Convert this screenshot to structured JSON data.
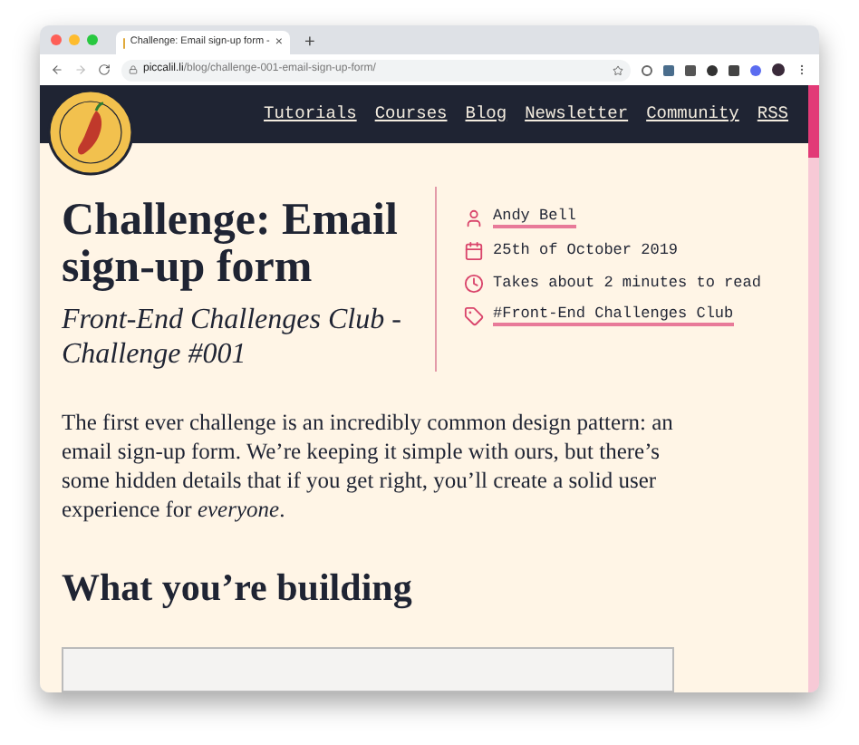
{
  "browser": {
    "tab_title": "Challenge: Email sign-up form -",
    "tab_close": "×",
    "new_tab": "+",
    "url_host": "piccalil.li",
    "url_path": "/blog/challenge-001-email-sign-up-form/"
  },
  "nav": {
    "links": [
      "Tutorials",
      "Courses",
      "Blog",
      "Newsletter",
      "Community",
      "RSS"
    ]
  },
  "article": {
    "title": "Challenge: Email sign-up form",
    "subtitle": "Front-End Challenges Club - Challenge #001",
    "meta": [
      {
        "kind": "author",
        "text": "Andy Bell",
        "link": true
      },
      {
        "kind": "date",
        "text": "25th of October 2019",
        "link": false
      },
      {
        "kind": "time",
        "text": "Takes about 2 minutes to read",
        "link": false
      },
      {
        "kind": "tag",
        "text": "#Front-End Challenges Club",
        "link": true
      }
    ],
    "intro": "The first ever challenge is an incredibly common design pattern: an email sign-up form. We’re keeping it simple with ours, but there’s some hidden details that if you get right, you’ll create a solid user experience for *everyone*.",
    "section_heading": "What you’re building"
  }
}
